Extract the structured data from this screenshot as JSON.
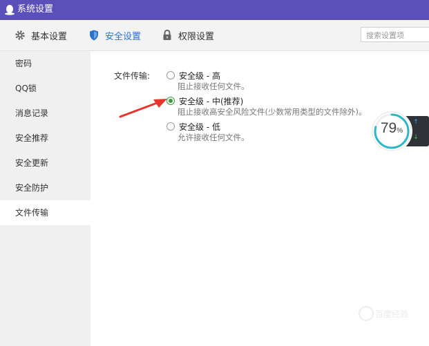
{
  "window": {
    "title": "系统设置",
    "title_bar_color": "#5b4fb9"
  },
  "toolbar": {
    "tabs": [
      {
        "label": "基本设置",
        "icon": "gear-icon",
        "active": false
      },
      {
        "label": "安全设置",
        "icon": "shield-icon",
        "active": true
      },
      {
        "label": "权限设置",
        "icon": "lock-icon",
        "active": false
      }
    ],
    "search_placeholder": "搜索设置项",
    "active_color": "#2d72c8"
  },
  "sidebar": {
    "items": [
      {
        "label": "密码"
      },
      {
        "label": "QQ锁"
      },
      {
        "label": "消息记录"
      },
      {
        "label": "安全推荐"
      },
      {
        "label": "安全更新"
      },
      {
        "label": "安全防护"
      },
      {
        "label": "文件传输",
        "active": true
      }
    ]
  },
  "file_transfer": {
    "label": "文件传输:",
    "options": [
      {
        "title": "安全级 - 高",
        "desc": "阻止接收任何文件。",
        "checked": false
      },
      {
        "title": "安全级 - 中(推荐)",
        "desc": "阻止接收高安全风险文件(少数常用类型的文件除外)。",
        "checked": true
      },
      {
        "title": "安全级 - 低",
        "desc": "允许接收任何文件。",
        "checked": false
      }
    ]
  },
  "speed_widget": {
    "value": "79",
    "unit": "%",
    "level": 0.79,
    "up_arrow": "↑",
    "down_arrow": "↓"
  },
  "annotation": {
    "arrow_color": "#e8352b"
  },
  "watermark": {
    "text": "百度经验"
  }
}
